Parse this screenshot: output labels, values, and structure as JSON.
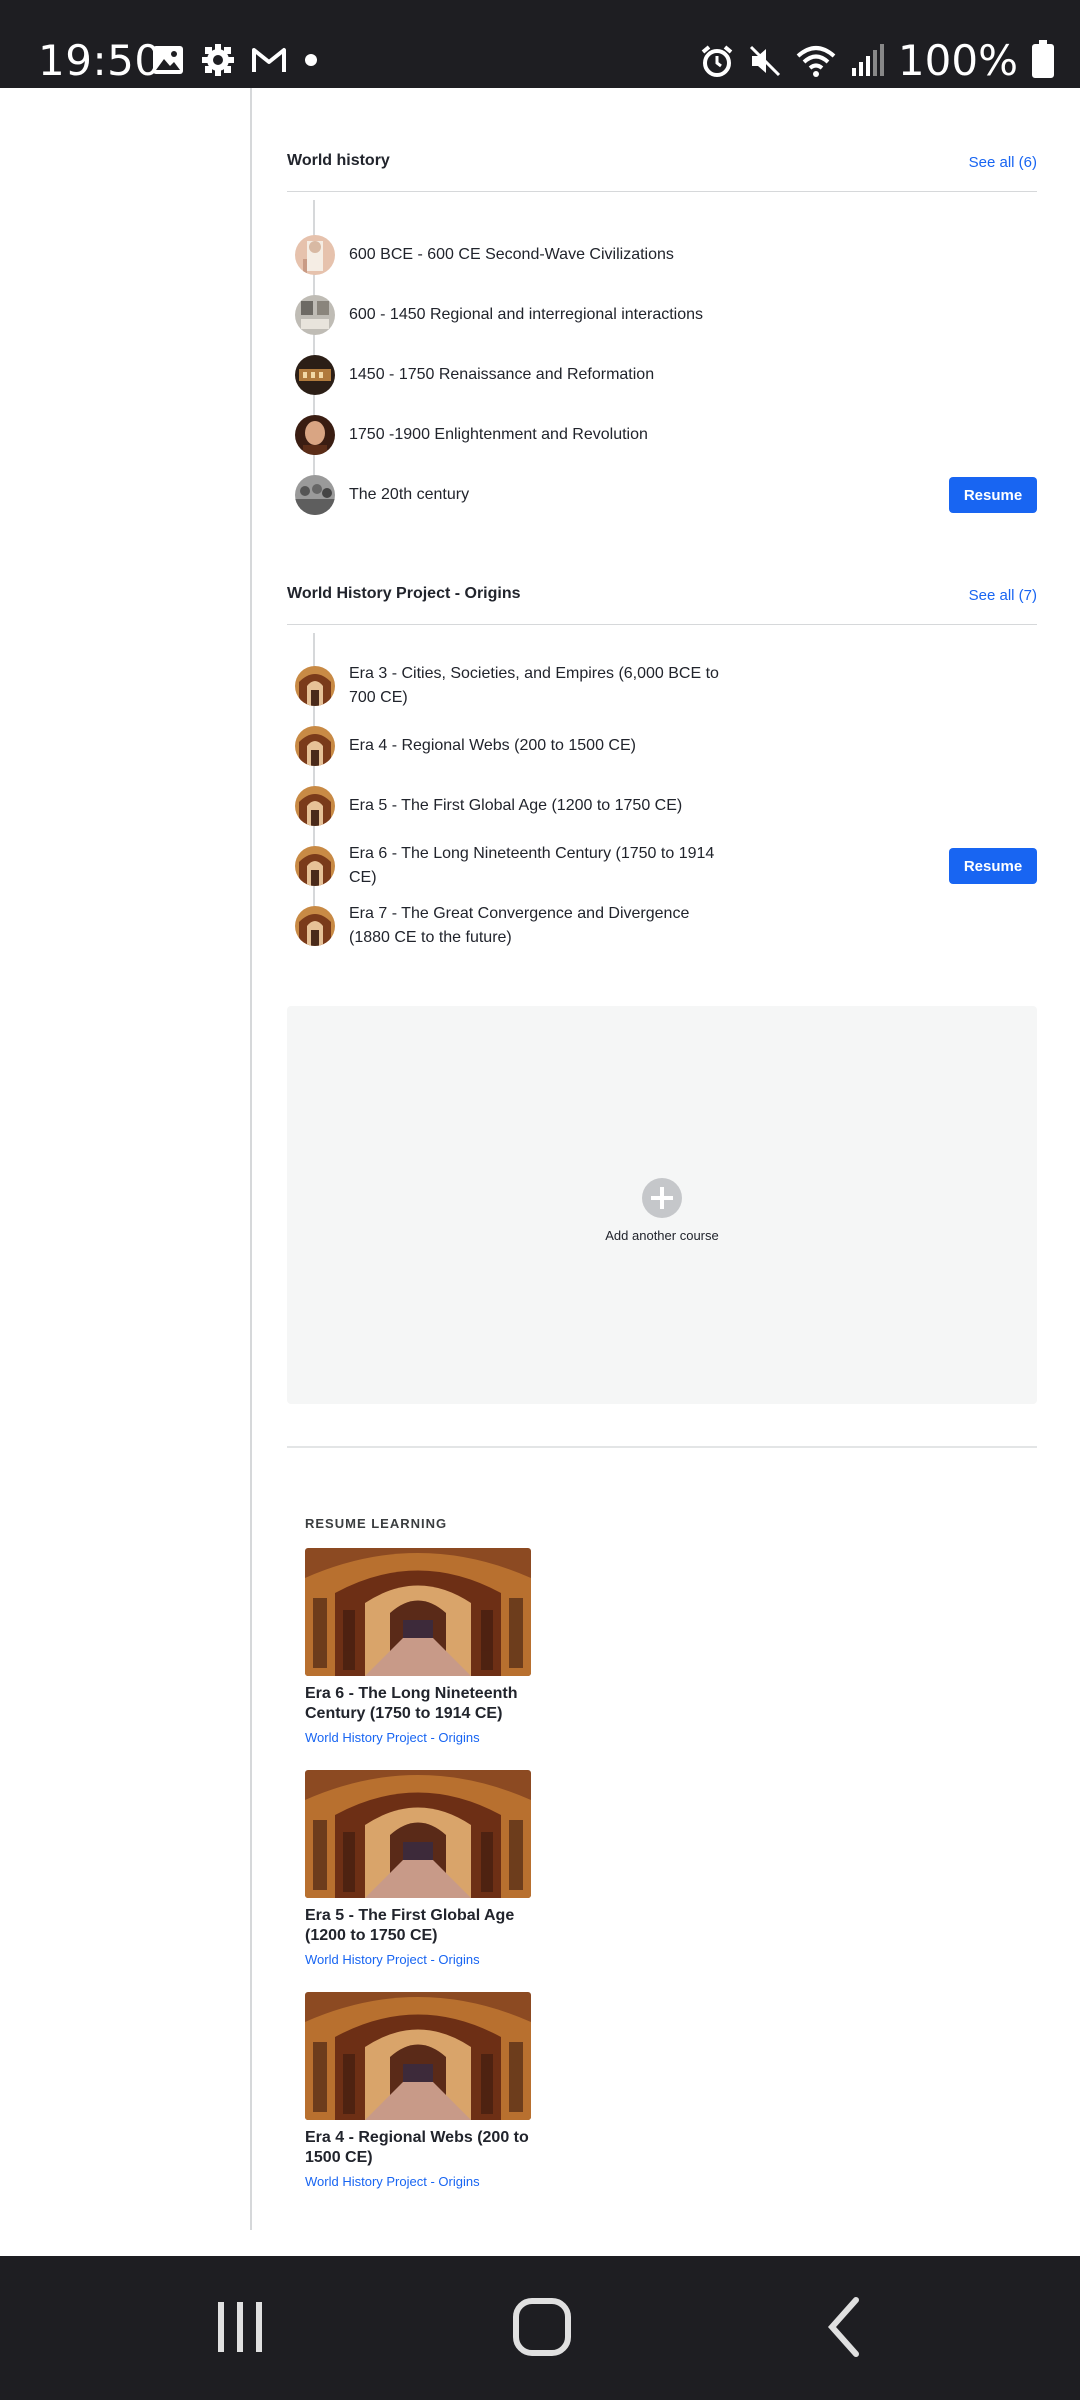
{
  "status_bar": {
    "time": "19:50",
    "battery": "100%",
    "left_icons": [
      "image-icon",
      "settings-icon",
      "gmail-icon",
      "dot-icon"
    ],
    "right_icons": [
      "alarm-icon",
      "mute-icon",
      "wifi-icon",
      "signal-icon",
      "battery-icon"
    ]
  },
  "sections": [
    {
      "title": "World history",
      "see_all": "See all (6)",
      "units": [
        {
          "title": "600 BCE - 600 CE Second-Wave Civilizations",
          "thumb": "statue",
          "resume": ""
        },
        {
          "title": "600 - 1450 Regional and interregional interactions",
          "thumb": "manuscript",
          "resume": ""
        },
        {
          "title": "1450 - 1750 Renaissance and Reformation",
          "thumb": "painting",
          "resume": ""
        },
        {
          "title": "1750 -1900 Enlightenment and Revolution",
          "thumb": "portrait",
          "resume": ""
        },
        {
          "title": "The 20th century",
          "thumb": "crowd",
          "resume": "Resume"
        }
      ]
    },
    {
      "title": "World History Project - Origins",
      "see_all": "See all (7)",
      "units": [
        {
          "title": "Era 3 - Cities, Societies, and Empires (6,000 BCE to 700 CE)",
          "thumb": "library",
          "resume": ""
        },
        {
          "title": "Era 4 - Regional Webs (200 to 1500 CE)",
          "thumb": "library",
          "resume": ""
        },
        {
          "title": "Era 5 - The First Global Age (1200 to 1750 CE)",
          "thumb": "library",
          "resume": ""
        },
        {
          "title": "Era 6 - The Long Nineteenth Century (1750 to 1914 CE)",
          "thumb": "library",
          "resume": "Resume"
        },
        {
          "title": "Era 7 - The Great Convergence and Divergence (1880 CE to the future)",
          "thumb": "library",
          "resume": ""
        }
      ]
    }
  ],
  "add_course": {
    "label": "Add another course",
    "icon": "plus-circle-icon"
  },
  "resume_learning": {
    "heading": "RESUME LEARNING",
    "cards": [
      {
        "title": "Era 6 - The Long Nineteenth Century (1750 to 1914 CE)",
        "course": "World History Project - Origins"
      },
      {
        "title": "Era 5 - The First Global Age (1200 to 1750 CE)",
        "course": "World History Project - Origins"
      },
      {
        "title": "Era 4 - Regional Webs (200 to 1500 CE)",
        "course": "World History Project - Origins"
      }
    ]
  },
  "nav_bar": {
    "icons": [
      "recents-icon",
      "home-icon",
      "back-icon"
    ]
  },
  "colors": {
    "accent": "#1865f2",
    "footer": "#0a2a66",
    "card_bg": "#f5f6f6"
  }
}
